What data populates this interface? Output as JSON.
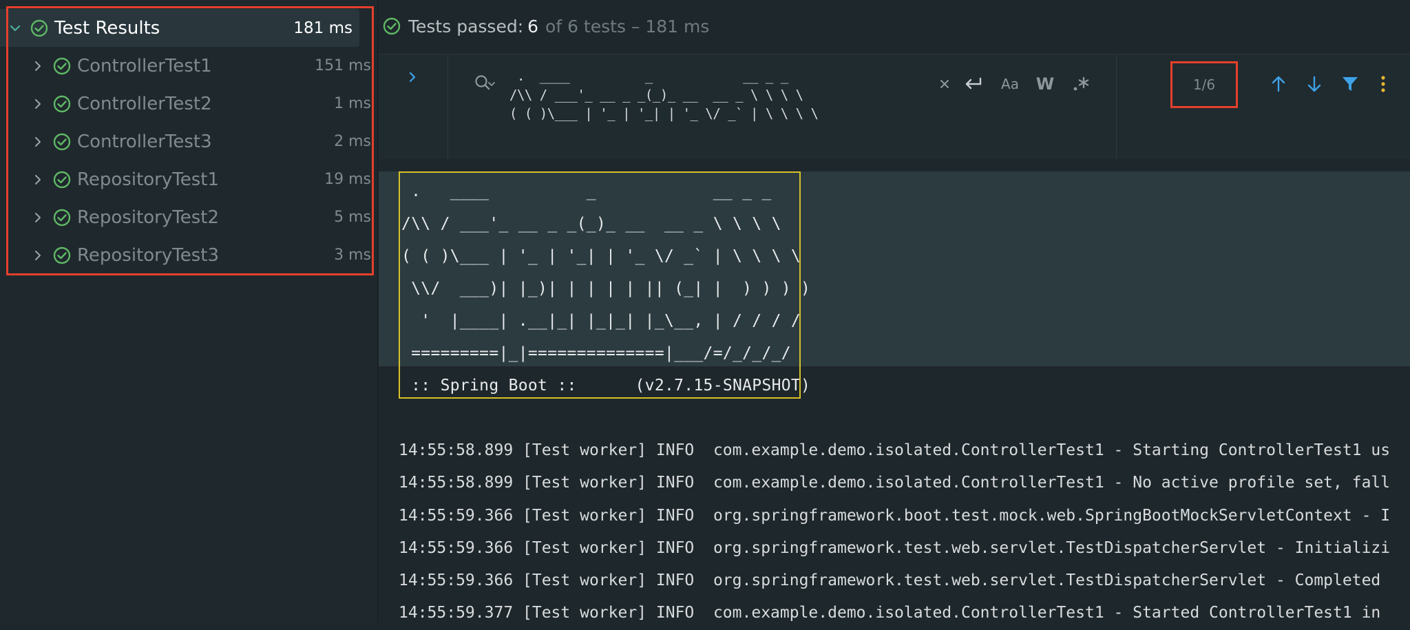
{
  "tree": {
    "root": {
      "label": "Test Results",
      "time": "181 ms"
    },
    "items": [
      {
        "label": "ControllerTest1",
        "time": "151 ms"
      },
      {
        "label": "ControllerTest2",
        "time": "1 ms"
      },
      {
        "label": "ControllerTest3",
        "time": "2 ms"
      },
      {
        "label": "RepositoryTest1",
        "time": "19 ms"
      },
      {
        "label": "RepositoryTest2",
        "time": "5 ms"
      },
      {
        "label": "RepositoryTest3",
        "time": "3 ms"
      }
    ]
  },
  "status": {
    "prefix": "Tests passed:",
    "passed": "6",
    "suffix": "of 6 tests – 181 ms"
  },
  "search": {
    "query": " .  ____          _            __ _ _\n/\\\\ / ___'_ __ _ _(_)_ __  __ _ \\ \\ \\ \\\n( ( )\\___ | '_ | '_| | '_ \\/ _` | \\ \\ \\ \\",
    "match_count": "1/6",
    "icons": {
      "clear": "close-icon",
      "newline": "newline-icon",
      "match_case": "Aa",
      "words": "W",
      "regex": ".*"
    }
  },
  "console": {
    "banner": " .   ____          _            __ _ _\n/\\\\ / ___'_ __ _ _(_)_ __  __ _ \\ \\ \\ \\\n( ( )\\___ | '_ | '_| | '_ \\/ _` | \\ \\ \\ \\\n \\\\/  ___)| |_)| | | | | || (_| |  ) ) ) )\n  '  |____| .__|_| |_|_| |_\\__, | / / / /\n =========|_|==============|___/=/_/_/_/\n :: Spring Boot ::      (v2.7.15-SNAPSHOT)",
    "log_lines": [
      "14:55:58.899 [Test worker] INFO  com.example.demo.isolated.ControllerTest1 - Starting ControllerTest1 us",
      "14:55:58.899 [Test worker] INFO  com.example.demo.isolated.ControllerTest1 - No active profile set, fall",
      "14:55:59.366 [Test worker] INFO  org.springframework.boot.test.mock.web.SpringBootMockServletContext - I",
      "14:55:59.366 [Test worker] INFO  org.springframework.test.web.servlet.TestDispatcherServlet - Initializi",
      "14:55:59.366 [Test worker] INFO  org.springframework.test.web.servlet.TestDispatcherServlet - Completed ",
      "14:55:59.377 [Test worker] INFO  com.example.demo.isolated.ControllerTest1 - Started ControllerTest1 in "
    ]
  },
  "colors": {
    "pass_green": "#5fb865",
    "accent_blue": "#3ea2e8",
    "highlight_red": "#e5402b",
    "banner_border": "#d8c22a",
    "more_yellow": "#e8b730"
  }
}
